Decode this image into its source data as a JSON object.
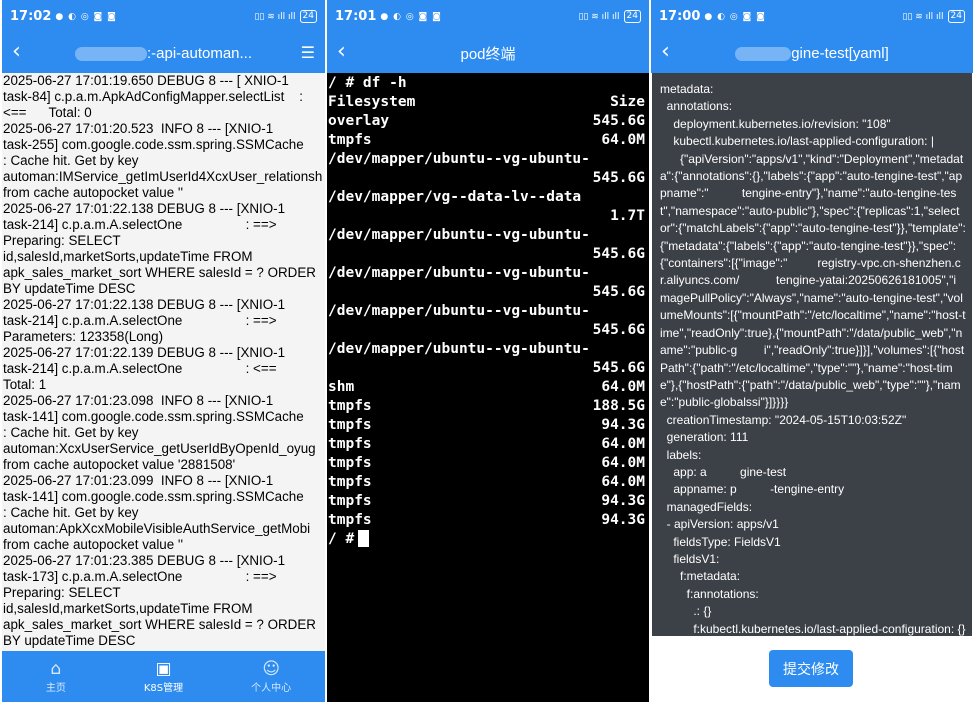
{
  "status_bars": [
    {
      "time": "17:02",
      "icons": "● ◐ ◎ ◙ ◙",
      "right": "▯▯ ≋ ıll ıll",
      "battery": "24"
    },
    {
      "time": "17:01",
      "icons": "● ◐ ◎ ◙ ◙",
      "right": "▯▯ ≋ ıll ıll",
      "battery": "24"
    },
    {
      "time": "17:00",
      "icons": "● ◐ ◎ ◙ ◙",
      "right": "▯▯ ≋ ıll ıll",
      "battery": "24"
    }
  ],
  "panel1": {
    "title": ":-api-automan...",
    "log_lines": [
      "2025-06-27 17:01:19.650 DEBUG 8 --- [ XNIO-1",
      "task-84] c.p.a.m.ApkAdConfigMapper.selectList    :",
      "<==      Total: 0",
      "2025-06-27 17:01:20.523  INFO 8 --- [XNIO-1",
      "task-255] com.google.code.ssm.spring.SSMCache",
      ": Cache hit. Get by key",
      "automan:IMService_getImUserId4XcxUser_relationsh",
      "from cache autopocket value ''",
      "2025-06-27 17:01:22.138 DEBUG 8 --- [XNIO-1",
      "task-214] c.p.a.m.A.selectOne                 : ==>",
      "Preparing: SELECT",
      "id,salesId,marketSorts,updateTime FROM",
      "apk_sales_market_sort WHERE salesId = ? ORDER",
      "BY updateTime DESC",
      "2025-06-27 17:01:22.138 DEBUG 8 --- [XNIO-1",
      "task-214] c.p.a.m.A.selectOne                 : ==>",
      "Parameters: 123358(Long)",
      "2025-06-27 17:01:22.139 DEBUG 8 --- [XNIO-1",
      "task-214] c.p.a.m.A.selectOne                 : <==",
      "Total: 1",
      "2025-06-27 17:01:23.098  INFO 8 --- [XNIO-1",
      "task-141] com.google.code.ssm.spring.SSMCache",
      ": Cache hit. Get by key",
      "automan:XcxUserService_getUserIdByOpenId_oyug",
      "from cache autopocket value '2881508'",
      "2025-06-27 17:01:23.099  INFO 8 --- [XNIO-1",
      "task-141] com.google.code.ssm.spring.SSMCache",
      ": Cache hit. Get by key",
      "automan:ApkXcxMobileVisibleAuthService_getMobi",
      "from cache autopocket value ''",
      "2025-06-27 17:01:23.385 DEBUG 8 --- [XNIO-1",
      "task-173] c.p.a.m.A.selectOne                 : ==>",
      "Preparing: SELECT",
      "id,salesId,marketSorts,updateTime FROM",
      "apk_sales_market_sort WHERE salesId = ? ORDER",
      "BY updateTime DESC"
    ],
    "nav": [
      {
        "label": "主页",
        "icon": "⌂"
      },
      {
        "label": "K8S管理",
        "icon": "▣"
      },
      {
        "label": "个人中心",
        "icon": "☺"
      }
    ]
  },
  "panel2": {
    "title": "pod终端",
    "command": "/ # df -h",
    "rows": [
      {
        "l": "Filesystem",
        "r": "Size"
      },
      {
        "l": "overlay",
        "r": "545.6G"
      },
      {
        "l": "tmpfs",
        "r": "64.0M"
      },
      {
        "l": "/dev/mapper/ubuntu--vg-ubuntu-",
        "r": ""
      },
      {
        "l": "",
        "r": "545.6G"
      },
      {
        "l": "/dev/mapper/vg--data-lv--data",
        "r": ""
      },
      {
        "l": "",
        "r": "1.7T"
      },
      {
        "l": "/dev/mapper/ubuntu--vg-ubuntu-",
        "r": ""
      },
      {
        "l": "",
        "r": "545.6G"
      },
      {
        "l": "/dev/mapper/ubuntu--vg-ubuntu-",
        "r": ""
      },
      {
        "l": "",
        "r": "545.6G"
      },
      {
        "l": "/dev/mapper/ubuntu--vg-ubuntu-",
        "r": ""
      },
      {
        "l": "",
        "r": "545.6G"
      },
      {
        "l": "/dev/mapper/ubuntu--vg-ubuntu-",
        "r": ""
      },
      {
        "l": "",
        "r": "545.6G"
      },
      {
        "l": "shm",
        "r": "64.0M"
      },
      {
        "l": "tmpfs",
        "r": "188.5G"
      },
      {
        "l": "tmpfs",
        "r": "94.3G"
      },
      {
        "l": "tmpfs",
        "r": "64.0M"
      },
      {
        "l": "tmpfs",
        "r": "64.0M"
      },
      {
        "l": "tmpfs",
        "r": "64.0M"
      },
      {
        "l": "tmpfs",
        "r": "94.3G"
      },
      {
        "l": "tmpfs",
        "r": "94.3G"
      }
    ],
    "prompt": "/ #"
  },
  "panel3": {
    "title": "gine-test[yaml]",
    "yaml_lines": [
      "metadata:",
      "  annotations:",
      "    deployment.kubernetes.io/revision: \"108\"",
      "    kubectl.kubernetes.io/last-applied-configuration: |",
      "      {\"apiVersion\":\"apps/v1\",\"kind\":\"Deployment\",\"metadata\":{\"annotations\":{},\"labels\":{\"app\":\"auto-tengine-test\",\"appname\":\"          tengine-entry\"},\"name\":\"auto-tengine-test\",\"namespace\":\"auto-public\"},\"spec\":{\"replicas\":1,\"selector\":{\"matchLabels\":{\"app\":\"auto-tengine-test\"}},\"template\":{\"metadata\":{\"labels\":{\"app\":\"auto-tengine-test\"}},\"spec\":{\"containers\":[{\"image\":\"         registry-vpc.cn-shenzhen.cr.aliyuncs.com/           tengine-yatai:20250626181005\",\"imagePullPolicy\":\"Always\",\"name\":\"auto-tengine-test\",\"volumeMounts\":[{\"mountPath\":\"/etc/localtime\",\"name\":\"host-time\",\"readOnly\":true},{\"mountPath\":\"/data/public_web\",\"name\":\"public-g        i\",\"readOnly\":true}]}],\"volumes\":[{\"hostPath\":{\"path\":\"/etc/localtime\",\"type\":\"\"},\"name\":\"host-time\"},{\"hostPath\":{\"path\":\"/data/public_web\",\"type\":\"\"},\"name\":\"public-globalssi\"}]}}}}",
      "  creationTimestamp: \"2024-05-15T10:03:52Z\"",
      "  generation: 111",
      "  labels:",
      "    app: a          gine-test",
      "    appname: p          -tengine-entry",
      "  managedFields:",
      "  - apiVersion: apps/v1",
      "    fieldsType: FieldsV1",
      "    fieldsV1:",
      "      f:metadata:",
      "        f:annotations:",
      "          .: {}",
      "          f:kubectl.kubernetes.io/last-applied-configuration: {}"
    ],
    "submit_label": "提交修改"
  }
}
